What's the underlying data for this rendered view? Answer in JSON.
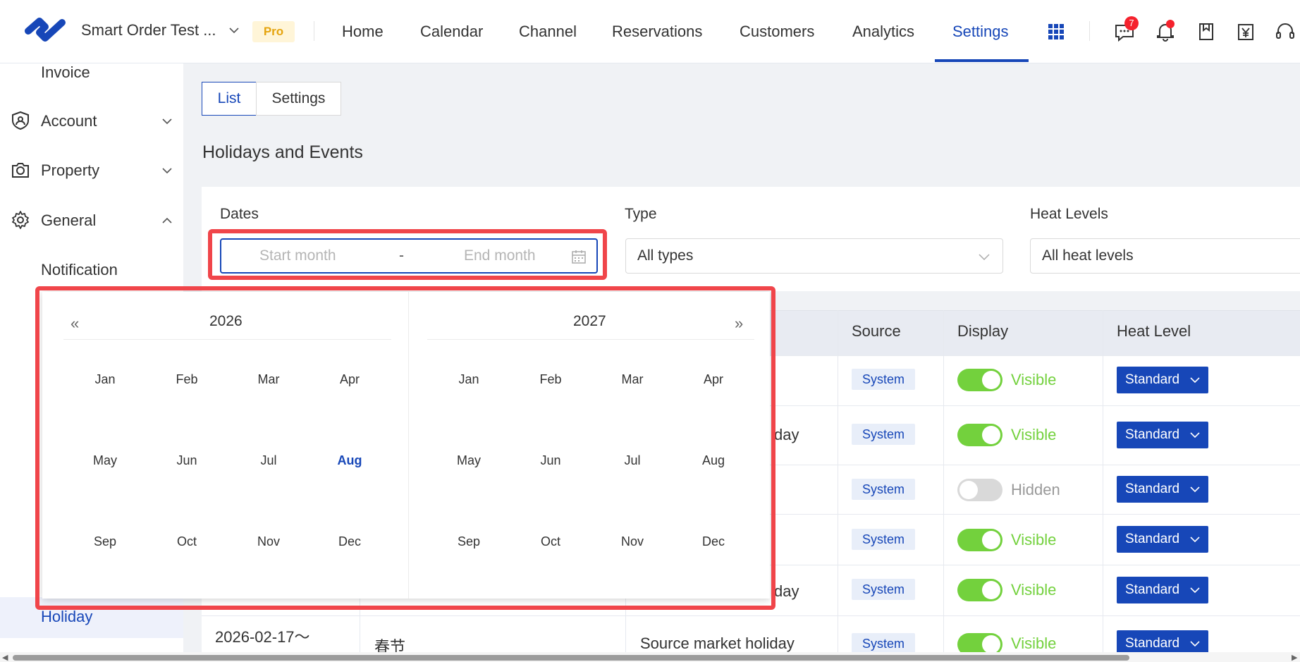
{
  "header": {
    "brand": "Smart Order Test ...",
    "pro_badge": "Pro",
    "nav": [
      "Home",
      "Calendar",
      "Channel",
      "Reservations",
      "Customers",
      "Analytics",
      "Settings"
    ],
    "active_nav": "Settings",
    "message_count": "7",
    "icons": [
      "logo-icon",
      "chevron-down-icon",
      "apps-grid-icon",
      "message-icon",
      "bell-icon",
      "bookmark-icon",
      "yen-invoice-icon",
      "headset-icon"
    ]
  },
  "sidebar": {
    "items": [
      {
        "label": "Invoice"
      },
      {
        "label": "Account",
        "icon": "shield-user-icon"
      },
      {
        "label": "Property",
        "icon": "camera-icon"
      },
      {
        "label": "General",
        "icon": "gear-icon"
      },
      {
        "label": "Notification"
      },
      {
        "label": "Holiday"
      }
    ]
  },
  "tabs": {
    "list": "List",
    "settings": "Settings"
  },
  "page_title": "Holidays and Events",
  "filters": {
    "dates_label": "Dates",
    "start_placeholder": "Start month",
    "range_sep": "-",
    "end_placeholder": "End month",
    "type_label": "Type",
    "type_value": "All types",
    "heat_label": "Heat Levels",
    "heat_value": "All heat levels"
  },
  "picker": {
    "left_year": "2026",
    "right_year": "2027",
    "prev_symbol": "«",
    "next_symbol": "»",
    "months": [
      "Jan",
      "Feb",
      "Mar",
      "Apr",
      "May",
      "Jun",
      "Jul",
      "Aug",
      "Sep",
      "Oct",
      "Nov",
      "Dec"
    ],
    "current_month": "Aug",
    "highlight_color": "#1747b8"
  },
  "table": {
    "headers": {
      "source": "Source",
      "display": "Display",
      "heat_level": "Heat Level"
    },
    "rows": [
      {
        "source": "System",
        "display": "Visible",
        "on": true,
        "heat": "Standard",
        "partial": ""
      },
      {
        "source": "System",
        "display": "Visible",
        "on": true,
        "heat": "Standard",
        "partial": "day"
      },
      {
        "source": "System",
        "display": "Hidden",
        "on": false,
        "heat": "Standard",
        "partial": ""
      },
      {
        "source": "System",
        "display": "Visible",
        "on": true,
        "heat": "Standard",
        "partial": ""
      },
      {
        "source": "System",
        "display": "Visible",
        "on": true,
        "heat": "Standard",
        "partial": "day"
      },
      {
        "source": "System",
        "display": "Visible",
        "on": true,
        "heat": "Standard",
        "date": "2026-02-17～",
        "name": "春节",
        "type": "Source market holiday"
      }
    ]
  },
  "colors": {
    "primary": "#1747b8",
    "highlight_red": "#f0454a",
    "toggle_on": "#73d13d"
  }
}
